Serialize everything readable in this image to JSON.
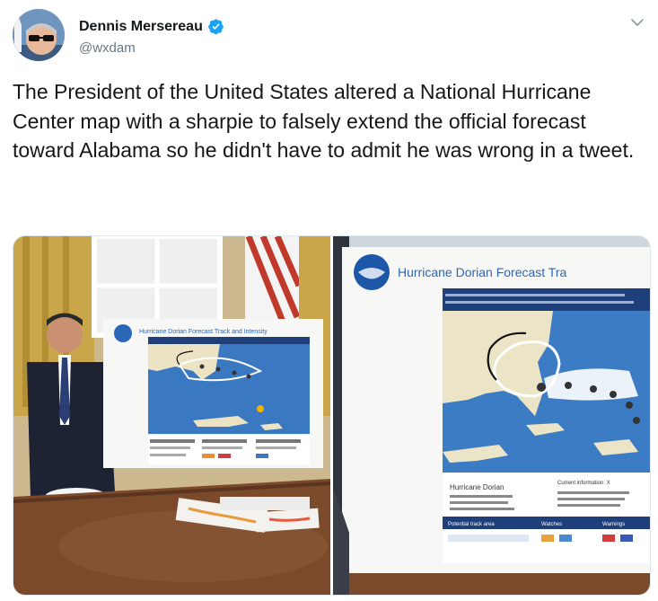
{
  "author": {
    "display_name": "Dennis Mersereau",
    "handle": "@wxdam",
    "verified": true,
    "avatar_icon": "avatar-photo"
  },
  "tweet": {
    "text": "The President of the United States altered a National Hurricane Center map with a sharpie to falsely extend the official forecast toward Alabama so he didn't have to admit he was wrong in a tweet."
  },
  "media": {
    "left_image": {
      "map_title": "Hurricane Dorian Forecast Track and Intensity"
    },
    "right_image": {
      "map_title": "Hurricane Dorian Forecast Tra",
      "legend_title": "Hurricane Dorian",
      "legend_current": "Current information: X",
      "legend_watches": "Watches",
      "legend_warnings": "Warnings",
      "legend_potential": "Potential track area"
    }
  },
  "colors": {
    "text_primary": "#14171a",
    "text_secondary": "#657786",
    "verified_blue": "#1da1f2",
    "ocean_blue": "#3a78c2"
  }
}
